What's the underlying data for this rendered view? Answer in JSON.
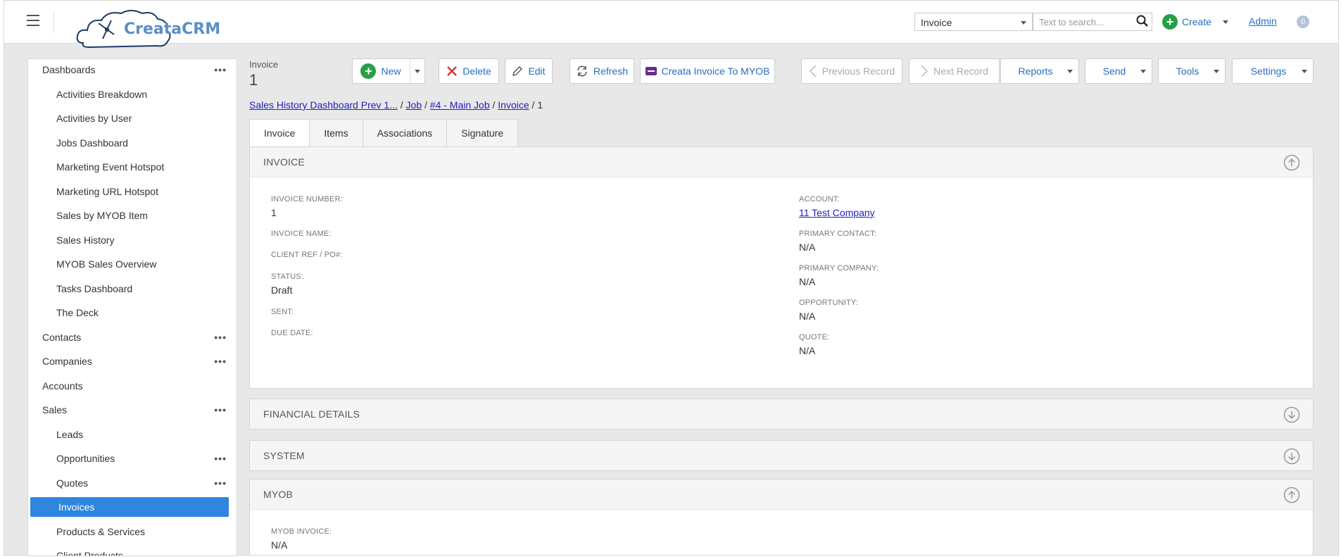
{
  "header": {
    "logo_text": "CreataCRM",
    "search_type": "Invoice",
    "search_placeholder": "Text to search...",
    "create_label": "Create",
    "admin_label": "Admin",
    "notifications_count": "0"
  },
  "sidebar": {
    "items": [
      {
        "label": "Dashboards",
        "level": 1,
        "dots": true
      },
      {
        "label": "Activities Breakdown",
        "level": 2
      },
      {
        "label": "Activities by User",
        "level": 2
      },
      {
        "label": "Jobs Dashboard",
        "level": 2
      },
      {
        "label": "Marketing Event Hotspot",
        "level": 2
      },
      {
        "label": "Marketing URL Hotspot",
        "level": 2
      },
      {
        "label": "Sales by MYOB Item",
        "level": 2
      },
      {
        "label": "Sales History",
        "level": 2
      },
      {
        "label": "MYOB Sales Overview",
        "level": 2
      },
      {
        "label": "Tasks Dashboard",
        "level": 2
      },
      {
        "label": "The Deck",
        "level": 2
      },
      {
        "label": "Contacts",
        "level": 1,
        "dots": true
      },
      {
        "label": "Companies",
        "level": 1,
        "dots": true
      },
      {
        "label": "Accounts",
        "level": 1
      },
      {
        "label": "Sales",
        "level": 1,
        "dots": true
      },
      {
        "label": "Leads",
        "level": 2
      },
      {
        "label": "Opportunities",
        "level": 2,
        "dots": true
      },
      {
        "label": "Quotes",
        "level": 2,
        "dots": true
      },
      {
        "label": "Invoices",
        "level": 2,
        "active": true
      },
      {
        "label": "Products & Services",
        "level": 2
      },
      {
        "label": "Client Products",
        "level": 2
      }
    ]
  },
  "record": {
    "type_label": "Invoice",
    "number": "1"
  },
  "toolbar": {
    "new_label": "New",
    "delete_label": "Delete",
    "edit_label": "Edit",
    "refresh_label": "Refresh",
    "myob_label": "Creata Invoice To MYOB",
    "prev_label": "Previous Record",
    "next_label": "Next Record",
    "reports_label": "Reports",
    "send_label": "Send",
    "tools_label": "Tools",
    "settings_label": "Settings"
  },
  "breadcrumb": {
    "items": [
      "Sales History Dashboard Prev 1...",
      "Job",
      "#4 - Main Job",
      "Invoice"
    ],
    "current": "1"
  },
  "tabs": [
    "Invoice",
    "Items",
    "Associations",
    "Signature"
  ],
  "sections": {
    "invoice": {
      "title": "INVOICE",
      "left_fields": [
        {
          "label": "INVOICE NUMBER:",
          "value": "1"
        },
        {
          "label": "INVOICE NAME:",
          "value": ""
        },
        {
          "label": "CLIENT REF / PO#:",
          "value": ""
        },
        {
          "label": "STATUS:",
          "value": "Draft"
        },
        {
          "label": "SENT:",
          "value": ""
        },
        {
          "label": "DUE DATE:",
          "value": ""
        }
      ],
      "right_fields": [
        {
          "label": "ACCOUNT:",
          "value": "11 Test Company",
          "link": true
        },
        {
          "label": "PRIMARY CONTACT:",
          "value": "N/A"
        },
        {
          "label": "PRIMARY COMPANY:",
          "value": "N/A"
        },
        {
          "label": "OPPORTUNITY:",
          "value": "N/A"
        },
        {
          "label": "QUOTE:",
          "value": "N/A"
        }
      ]
    },
    "financial": {
      "title": "FINANCIAL DETAILS"
    },
    "system": {
      "title": "SYSTEM"
    },
    "myob": {
      "title": "MYOB",
      "fields": [
        {
          "label": "MYOB INVOICE:",
          "value": "N/A"
        }
      ]
    }
  },
  "colors": {
    "accent": "#2a6dbf",
    "active_nav": "#2e86de",
    "green": "#27a046",
    "delete_red": "#d9332b",
    "myob_purple": "#6a2c8c"
  }
}
